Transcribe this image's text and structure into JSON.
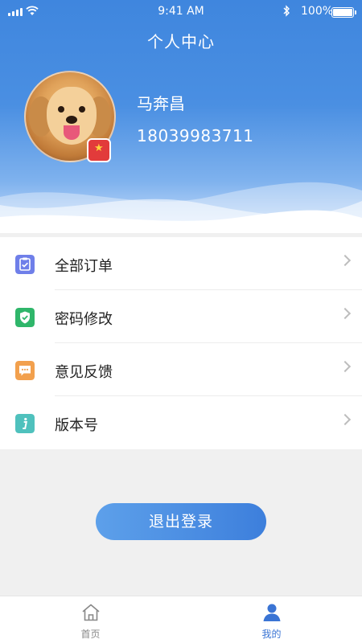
{
  "status_bar": {
    "time": "9:41 AM",
    "battery": "100%"
  },
  "header": {
    "title": "个人中心"
  },
  "user": {
    "name": "马奔昌",
    "phone": "18039983711"
  },
  "menu": [
    {
      "label": "全部订单",
      "icon": "clipboard-check-icon",
      "color": "#6f7fe9"
    },
    {
      "label": "密码修改",
      "icon": "shield-check-icon",
      "color": "#2fb66a"
    },
    {
      "label": "意见反馈",
      "icon": "message-dots-icon",
      "color": "#f2a04d"
    },
    {
      "label": "版本号",
      "icon": "info-icon",
      "color": "#4fc1bd"
    }
  ],
  "logout": {
    "label": "退出登录"
  },
  "tabbar": {
    "home": {
      "label": "首页",
      "color": "#888888"
    },
    "mine": {
      "label": "我的",
      "color": "#3a74d4"
    }
  },
  "colors": {
    "accent": "#3a74d4",
    "header_blue": "#4a8fe2",
    "background": "#f0f0f0"
  }
}
